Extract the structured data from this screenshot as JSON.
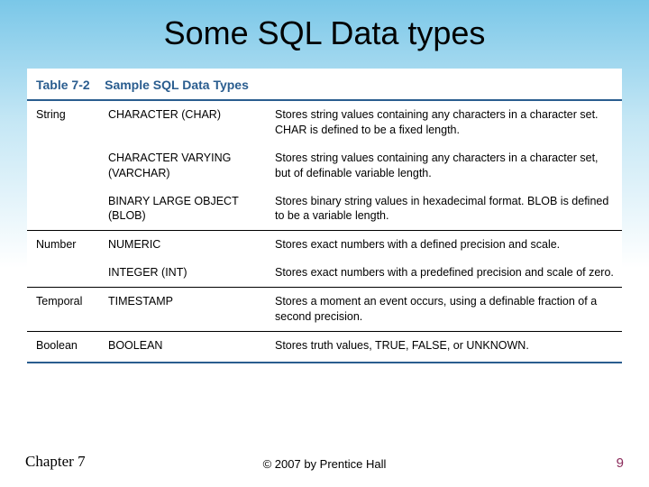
{
  "title": "Some SQL Data types",
  "table": {
    "caption_label": "Table 7-2",
    "caption_text": "Sample SQL Data Types",
    "rows": [
      {
        "category": "String",
        "type": "CHARACTER (CHAR)",
        "desc": "Stores string values containing any characters in a character set. CHAR is defined to be a fixed length."
      },
      {
        "category": "",
        "type": "CHARACTER VARYING (VARCHAR)",
        "desc": "Stores string values containing any characters in a character set, but of definable variable length."
      },
      {
        "category": "",
        "type": "BINARY LARGE OBJECT (BLOB)",
        "desc": "Stores binary string values in hexadecimal format. BLOB is defined to be a variable length."
      },
      {
        "category": "Number",
        "type": "NUMERIC",
        "desc": "Stores exact numbers with a defined precision and scale."
      },
      {
        "category": "",
        "type": "INTEGER (INT)",
        "desc": "Stores exact numbers with a predefined precision and scale of zero."
      },
      {
        "category": "Temporal",
        "type": "TIMESTAMP",
        "desc": "Stores a moment an event occurs, using a definable fraction of a second precision."
      },
      {
        "category": "Boolean",
        "type": "BOOLEAN",
        "desc": "Stores truth values, TRUE, FALSE, or UNKNOWN."
      }
    ]
  },
  "footer": {
    "left": "Chapter 7",
    "center": "© 2007 by Prentice Hall",
    "right": "9"
  }
}
